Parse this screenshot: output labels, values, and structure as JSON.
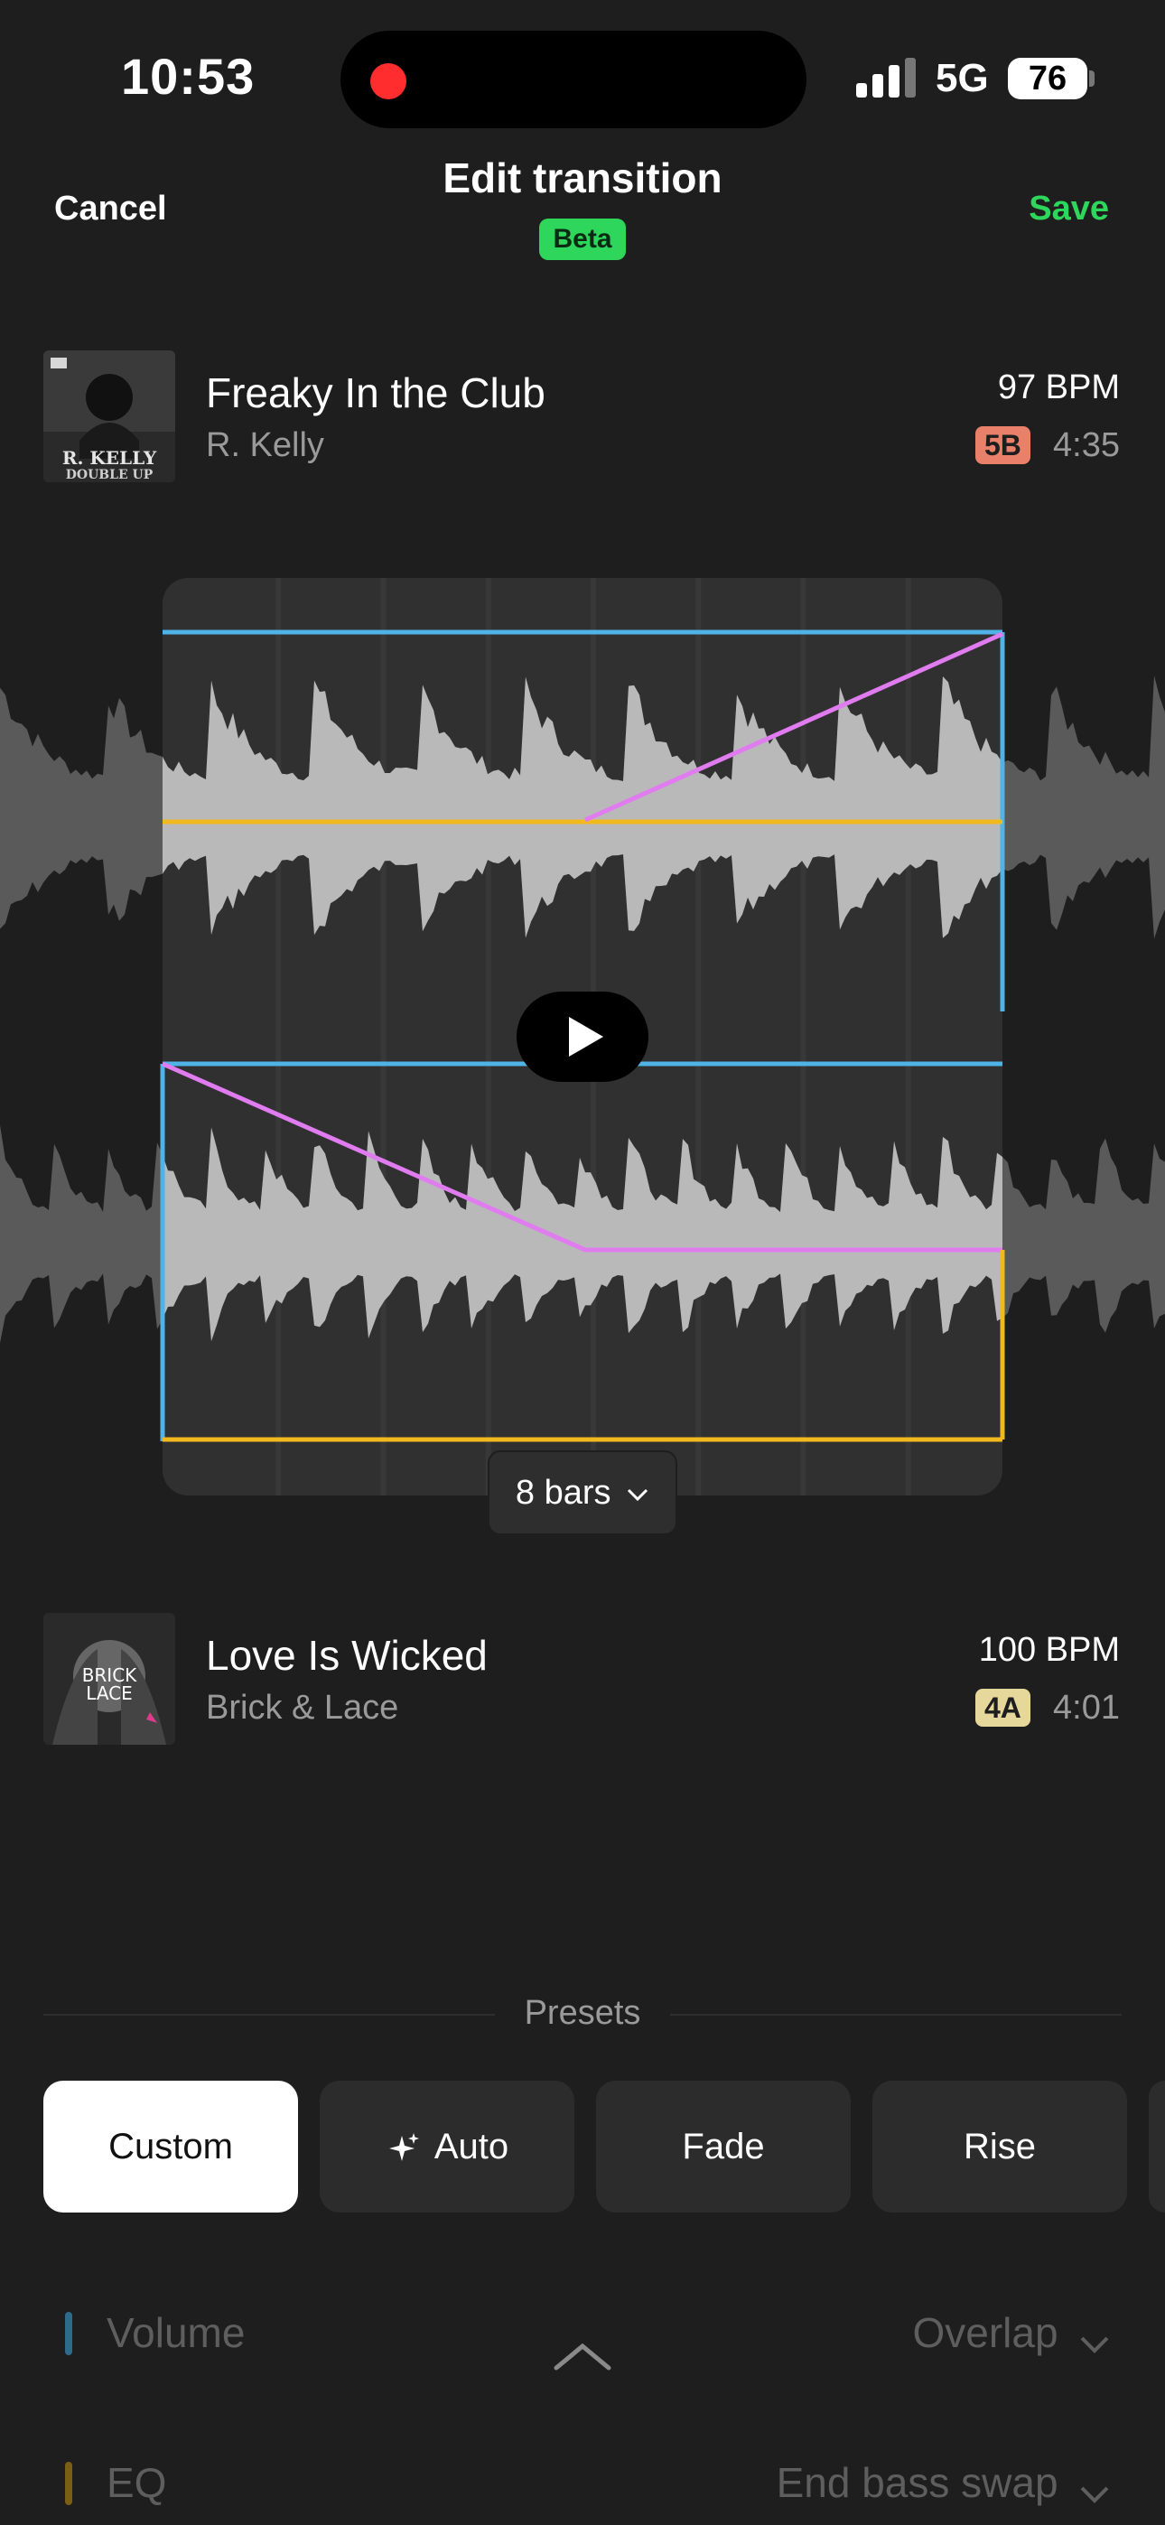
{
  "status_bar": {
    "time": "10:53",
    "network": "5G",
    "battery": "76"
  },
  "header": {
    "cancel_label": "Cancel",
    "title": "Edit transition",
    "badge": "Beta",
    "save_label": "Save"
  },
  "track_a": {
    "title": "Freaky In the Club",
    "artist": "R. Kelly",
    "bpm": "97 BPM",
    "key": "5B",
    "key_color": "#e8806a",
    "duration": "4:35",
    "art_text_1": "R. KELLY",
    "art_text_2": "DOUBLE UP"
  },
  "track_b": {
    "title": "Love Is Wicked",
    "artist": "Brick & Lace",
    "bpm": "100 BPM",
    "key": "4A",
    "key_color": "#e6d79a",
    "duration": "4:01",
    "art_text_1": "BRICK",
    "art_text_2": "LACE"
  },
  "transition": {
    "bars_label": "8 bars",
    "colors": {
      "volume": "#4fb3e8",
      "eq": "#f2b91f",
      "curve": "#e07cf0"
    }
  },
  "presets": {
    "label": "Presets",
    "items": [
      "Custom",
      "Auto",
      "Fade",
      "Rise"
    ],
    "selected": "Custom"
  },
  "settings": {
    "volume_label": "Volume",
    "volume_value": "Overlap",
    "eq_label": "EQ",
    "eq_value": "End bass swap"
  },
  "icons": [
    "play-icon",
    "chevron-down-icon",
    "sparkle-icon",
    "chevron-up-icon"
  ]
}
